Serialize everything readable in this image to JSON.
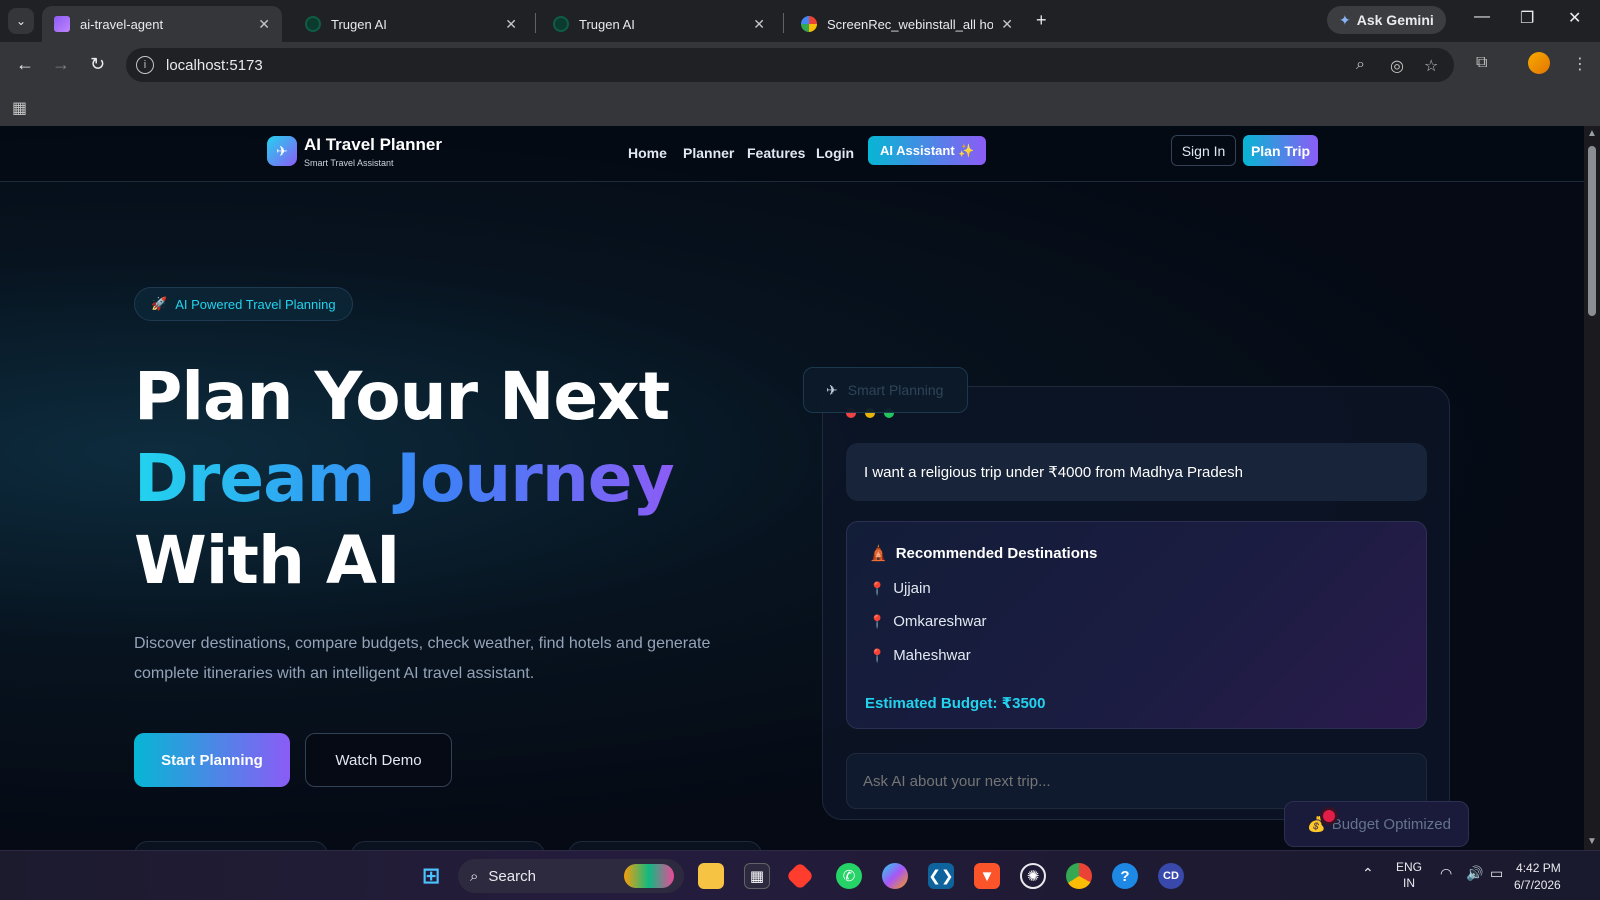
{
  "browser": {
    "tabs": [
      {
        "title": "ai-travel-agent",
        "active": true,
        "favicon_color": "#8b5cf6"
      },
      {
        "title": "Trugen AI",
        "active": false,
        "favicon_color": "#0b3b2e"
      },
      {
        "title": "Trugen AI",
        "active": false,
        "favicon_color": "#0b3b2e"
      },
      {
        "title": "ScreenRec_webinstall_all how to",
        "active": false,
        "favicon_color": "#4285f4"
      }
    ],
    "gemini_label": "Ask Gemini",
    "url": "localhost:5173"
  },
  "site": {
    "logo_title": "AI Travel Planner",
    "logo_subtitle": "Smart Travel Assistant",
    "nav": [
      "Home",
      "Planner",
      "Features",
      "Login"
    ],
    "ai_button": "AI Assistant ✨",
    "signin": "Sign In",
    "plan_trip": "Plan Trip"
  },
  "hero": {
    "pill": "AI Powered Travel Planning",
    "line1": "Plan Your Next",
    "line2": "Dream Journey",
    "line3": "With AI",
    "description": "Discover destinations, compare budgets, check weather, find hotels and generate complete itineraries with an intelligent AI travel assistant.",
    "start_button": "Start Planning",
    "demo_button": "Watch Demo"
  },
  "chat": {
    "badge": "Smart Planning",
    "query": "I want a religious trip under ₹4000 from Madhya Pradesh",
    "rec_title": "Recommended Destinations",
    "destinations": [
      "Ujjain",
      "Omkareshwar",
      "Maheshwar"
    ],
    "budget": "Estimated Budget: ₹3500",
    "input_placeholder": "Ask AI about your next trip...",
    "budget_badge": "Budget Optimized"
  },
  "taskbar": {
    "search_label": "Search",
    "lang_top": "ENG",
    "lang_bottom": "IN",
    "time": "4:42 PM",
    "date": "6/7/2026"
  }
}
